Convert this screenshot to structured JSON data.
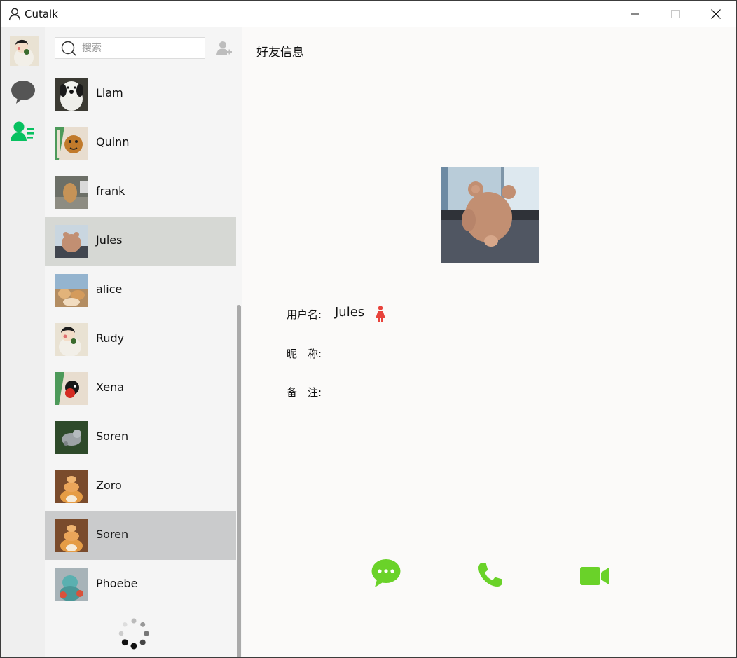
{
  "window": {
    "title": "Cutalk",
    "controls": [
      "minimize",
      "maximize",
      "close"
    ]
  },
  "navbar": {
    "items": [
      {
        "name": "avatar"
      },
      {
        "name": "chat-bubble-icon"
      },
      {
        "name": "contacts-icon",
        "active": true
      }
    ]
  },
  "search": {
    "placeholder": "搜索",
    "value": ""
  },
  "contacts": [
    {
      "name": "Liam"
    },
    {
      "name": "Quinn"
    },
    {
      "name": "frank"
    },
    {
      "name": "Jules",
      "state": "selected"
    },
    {
      "name": "alice"
    },
    {
      "name": "Rudy"
    },
    {
      "name": "Xena"
    },
    {
      "name": "Soren"
    },
    {
      "name": "Zoro"
    },
    {
      "name": "Soren",
      "state": "hover"
    },
    {
      "name": "Phoebe"
    }
  ],
  "detail": {
    "title": "好友信息",
    "username_label": "用户名:",
    "username_value": "Jules",
    "nickname_label": "昵　称:",
    "nickname_value": "",
    "remark_label": "备　注:",
    "remark_value": "",
    "gender_icon": "female-icon"
  },
  "colors": {
    "accent_green": "#07c160",
    "action_green": "#6ad229",
    "female_red": "#e8433c",
    "selected_row": "#d6d8d4",
    "hover_row": "#cacbcc"
  }
}
